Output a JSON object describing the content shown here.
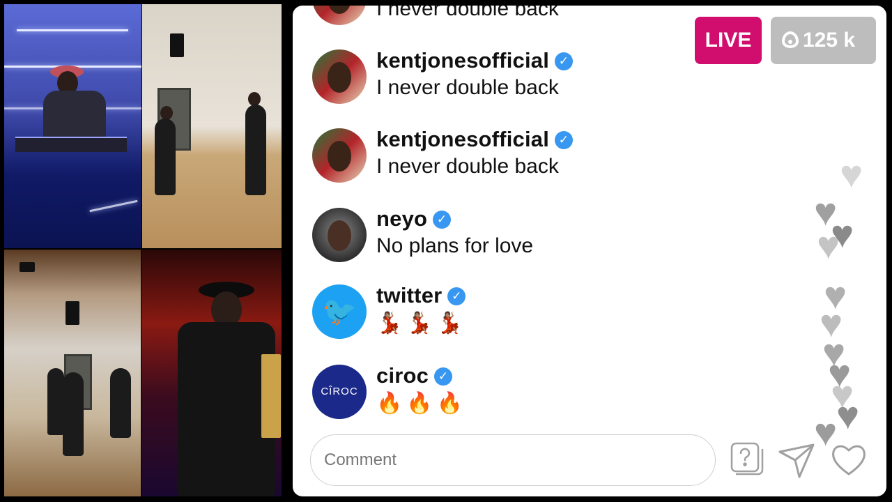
{
  "stream": {
    "live_label": "LIVE",
    "viewer_count": "125 k"
  },
  "comments": [
    {
      "username": "",
      "message": "I never double back",
      "verified": true,
      "avatar": "kentjones-avatar"
    },
    {
      "username": "kentjonesofficial",
      "message": "I never double back",
      "verified": true,
      "avatar": "kentjones-avatar"
    },
    {
      "username": "kentjonesofficial",
      "message": "I never double back",
      "verified": true,
      "avatar": "kentjones-avatar"
    },
    {
      "username": "neyo",
      "message": "No plans for love",
      "verified": true,
      "avatar": "neyo-avatar"
    },
    {
      "username": "twitter",
      "message": "💃🏽💃🏽💃🏽",
      "verified": true,
      "avatar": "twitter-logo"
    },
    {
      "username": "ciroc",
      "message": "🔥🔥🔥",
      "verified": true,
      "avatar": "ciroc-logo",
      "avatar_text": "CÎROC"
    }
  ],
  "composer": {
    "placeholder": "Comment"
  },
  "icons": {
    "verified": "✓",
    "twitter_bird": "🐦",
    "heart": "♥"
  },
  "colors": {
    "live_badge": "#d10e6e",
    "viewers_badge": "#bdbdbd",
    "verified": "#3897f0"
  }
}
